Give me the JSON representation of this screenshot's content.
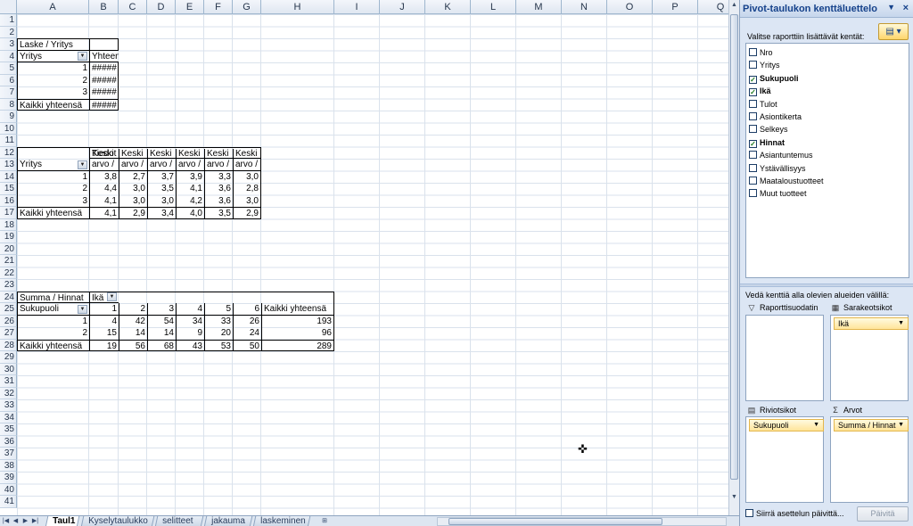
{
  "columns": [
    "A",
    "B",
    "C",
    "D",
    "E",
    "F",
    "G",
    "H",
    "I",
    "J",
    "K",
    "L",
    "M",
    "N",
    "O",
    "P",
    "Q"
  ],
  "rows": [
    "1",
    "2",
    "3",
    "4",
    "5",
    "6",
    "7",
    "8",
    "9",
    "10",
    "11",
    "12",
    "13",
    "14",
    "15",
    "16",
    "17",
    "18",
    "19",
    "20",
    "21",
    "22",
    "23",
    "24",
    "25",
    "26",
    "27",
    "28",
    "29",
    "30",
    "31",
    "32",
    "33",
    "34",
    "35",
    "36",
    "37",
    "38",
    "39",
    "40",
    "41"
  ],
  "pivot1": {
    "title": "Laske / Yritys",
    "row_field": "Yritys",
    "value_header": "Yhteensä",
    "rows": [
      {
        "label": "1",
        "value": "#####"
      },
      {
        "label": "2",
        "value": "#####"
      },
      {
        "label": "3",
        "value": "#####"
      }
    ],
    "total_label": "Kaikki yhteensä",
    "total_value": "#####"
  },
  "pivot2": {
    "data_header": "Tiedot",
    "row_field": "Yritys",
    "col_headers": [
      "Keski arvo /",
      "Keski arvo /",
      "Keski arvo /",
      "Keski arvo /",
      "Keski arvo /",
      "Keski arvo /"
    ],
    "rows": [
      {
        "label": "1",
        "values": [
          "3,8",
          "2,7",
          "3,7",
          "3,9",
          "3,3",
          "3,0"
        ]
      },
      {
        "label": "2",
        "values": [
          "4,4",
          "3,0",
          "3,5",
          "4,1",
          "3,6",
          "2,8"
        ]
      },
      {
        "label": "3",
        "values": [
          "4,1",
          "3,0",
          "3,0",
          "4,2",
          "3,6",
          "3,0"
        ]
      }
    ],
    "total_label": "Kaikki yhteensä",
    "total_values": [
      "4,1",
      "2,9",
      "3,4",
      "4,0",
      "3,5",
      "2,9"
    ]
  },
  "pivot3": {
    "title": "Summa / Hinnat",
    "col_field": "Ikä",
    "row_field": "Sukupuoli",
    "col_values": [
      "1",
      "2",
      "3",
      "4",
      "5",
      "6"
    ],
    "total_header": "Kaikki yhteensä",
    "rows": [
      {
        "label": "1",
        "values": [
          "4",
          "42",
          "54",
          "34",
          "33",
          "26"
        ],
        "total": "193"
      },
      {
        "label": "2",
        "values": [
          "15",
          "14",
          "14",
          "9",
          "20",
          "24"
        ],
        "total": "96"
      }
    ],
    "total_label": "Kaikki yhteensä",
    "total_values": [
      "19",
      "56",
      "68",
      "43",
      "53",
      "50"
    ],
    "grand_total": "289"
  },
  "sheet_tabs": [
    "Taul1",
    "Kyselytaulukko",
    "selitteet",
    "jakauma",
    "laskeminen"
  ],
  "active_tab": "Taul1",
  "field_pane": {
    "title": "Pivot-taulukon kenttäluettelo",
    "choose_label": "Valitse raporttiin lisättävät kentät:",
    "fields": [
      {
        "name": "Nro",
        "checked": false
      },
      {
        "name": "Yritys",
        "checked": false
      },
      {
        "name": "Sukupuoli",
        "checked": true
      },
      {
        "name": "Ikä",
        "checked": true
      },
      {
        "name": "Tulot",
        "checked": false
      },
      {
        "name": "Asiontikerta",
        "checked": false
      },
      {
        "name": "Selkeys",
        "checked": false
      },
      {
        "name": "Hinnat",
        "checked": true
      },
      {
        "name": "Asiantuntemus",
        "checked": false
      },
      {
        "name": "Ystävällisyys",
        "checked": false
      },
      {
        "name": "Maataloustuotteet",
        "checked": false
      },
      {
        "name": "Muut tuotteet",
        "checked": false
      }
    ],
    "drag_label": "Vedä kenttiä alla olevien alueiden välillä:",
    "areas": {
      "report_filter": {
        "label": "Raporttisuodatin",
        "items": []
      },
      "column_labels": {
        "label": "Sarakeotsikot",
        "items": [
          "Ikä"
        ]
      },
      "row_labels": {
        "label": "Riviotsikot",
        "items": [
          "Sukupuoli"
        ]
      },
      "values": {
        "label": "Arvot",
        "items": [
          "Summa / Hinnat"
        ]
      }
    },
    "defer_label": "Siirrä asettelun päivittä...",
    "update_button": "Päivitä"
  }
}
